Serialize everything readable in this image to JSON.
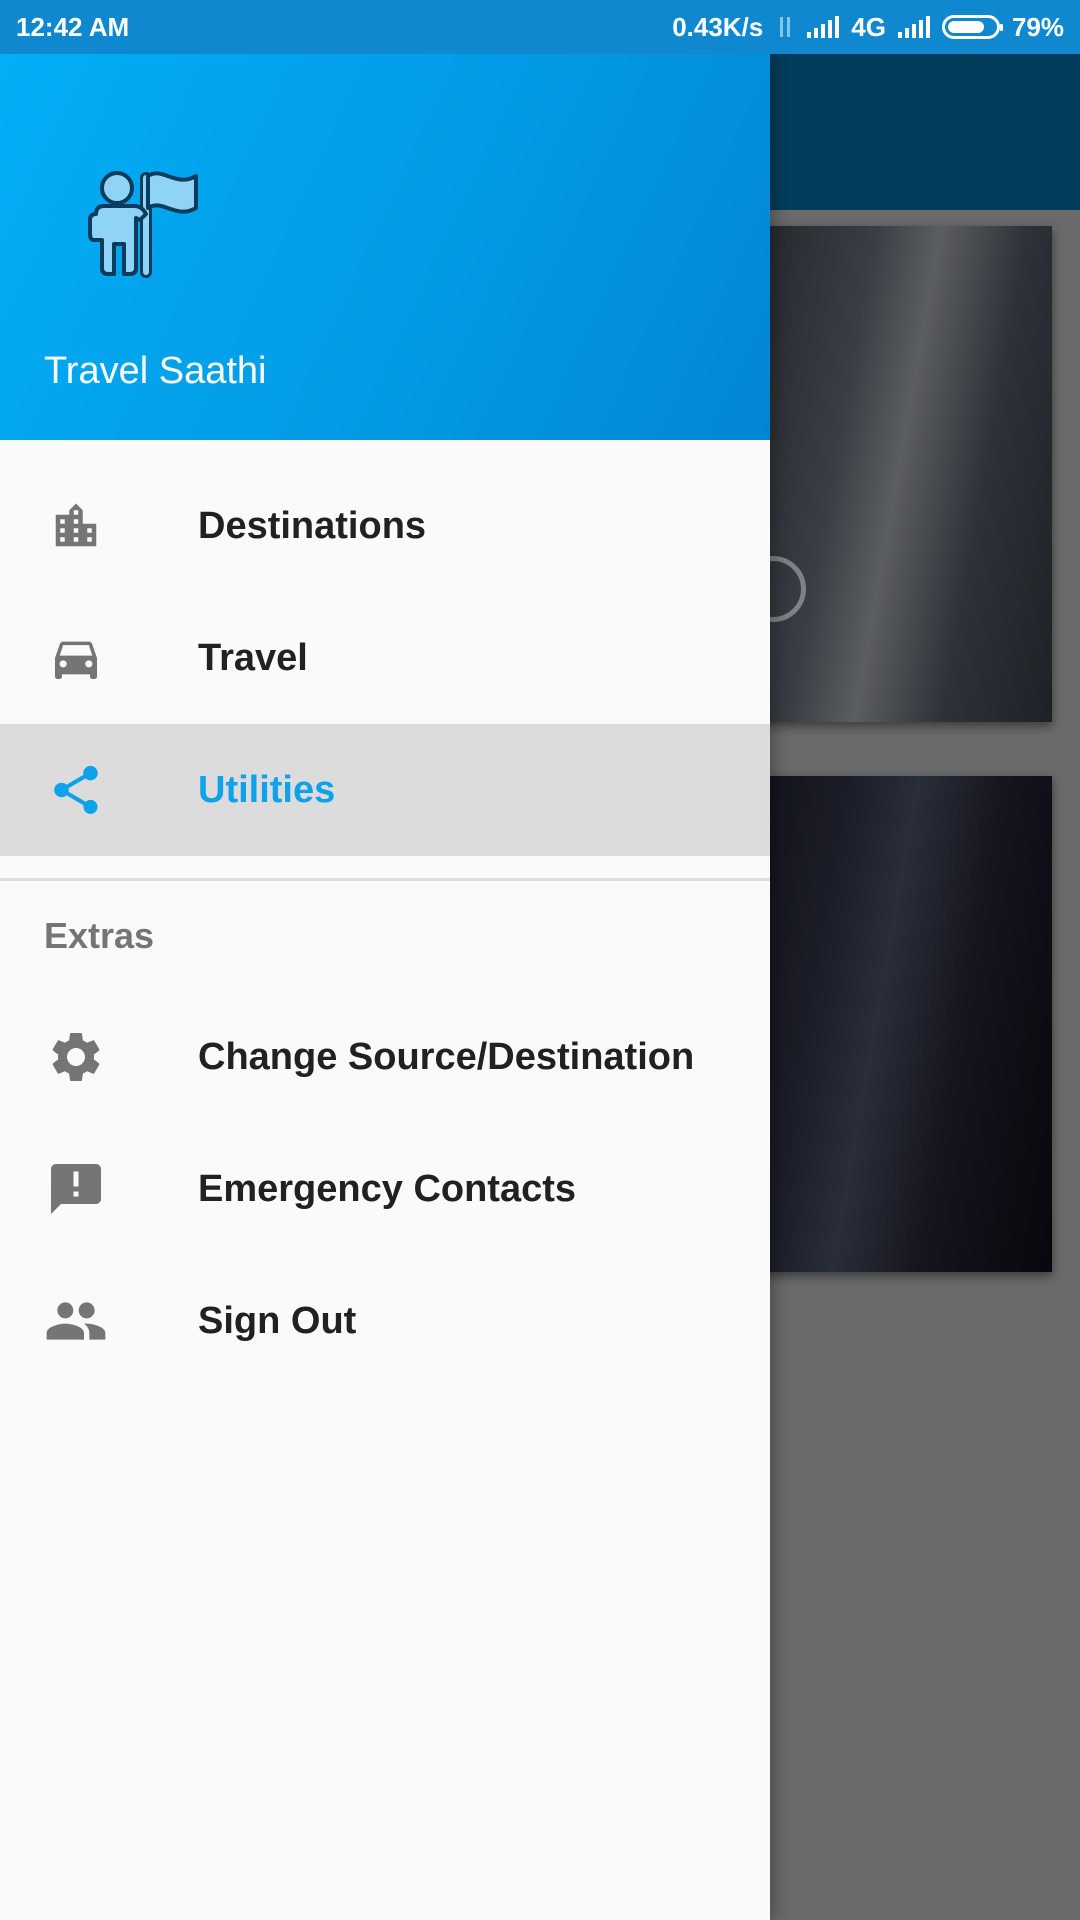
{
  "status_bar": {
    "time": "12:42 AM",
    "speed": "0.43K/s",
    "network": "4G",
    "battery": "79%",
    "battery_level": 0.79
  },
  "drawer": {
    "header": {
      "app_name": "Travel Saathi",
      "logo_icon": "traveler-flag-icon"
    },
    "menu": [
      {
        "label": "Destinations",
        "icon": "city-building-icon",
        "selected": false
      },
      {
        "label": "Travel",
        "icon": "car-icon",
        "selected": false
      },
      {
        "label": "Utilities",
        "icon": "share-icon",
        "selected": true
      }
    ],
    "extras": {
      "title": "Extras",
      "items": [
        {
          "label": "Change Source/Destination",
          "icon": "gear-icon"
        },
        {
          "label": "Emergency Contacts",
          "icon": "alert-message-icon"
        },
        {
          "label": "Sign Out",
          "icon": "people-icon"
        }
      ]
    }
  },
  "colors": {
    "status_bar": "#0f88cf",
    "header_gradient_start": "#02aef5",
    "header_gradient_end": "#0286d4",
    "accent": "#0ea2ea",
    "icon_gray": "#757575",
    "selected_bg": "#dcdcdc"
  }
}
